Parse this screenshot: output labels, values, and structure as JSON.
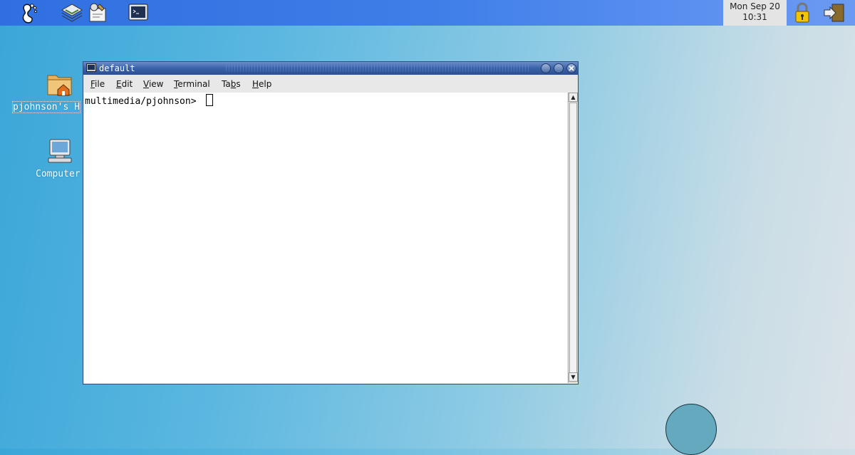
{
  "panel": {
    "launchers": [
      "gnome-foot-icon",
      "file-manager-icon",
      "help-icon",
      "terminal-launcher-icon"
    ],
    "clock": {
      "line1": "Mon Sep 20",
      "line2": "10:31"
    },
    "tray": [
      "lock-icon",
      "logout-icon"
    ]
  },
  "desktop": {
    "icons": [
      {
        "label": "pjohnson's H",
        "icon": "home-folder-icon"
      },
      {
        "label": "Computer",
        "icon": "computer-icon"
      }
    ]
  },
  "window": {
    "title": "default",
    "menu": [
      {
        "pre": "",
        "u": "F",
        "post": "ile"
      },
      {
        "pre": "",
        "u": "E",
        "post": "dit"
      },
      {
        "pre": "",
        "u": "V",
        "post": "iew"
      },
      {
        "pre": "",
        "u": "T",
        "post": "erminal"
      },
      {
        "pre": "Ta",
        "u": "b",
        "post": "s"
      },
      {
        "pre": "",
        "u": "H",
        "post": "elp"
      }
    ],
    "prompt": "multimedia/pjohnson> "
  },
  "colors": {
    "panel": "#3e7ee8",
    "titlebar": "#3a62a8"
  }
}
